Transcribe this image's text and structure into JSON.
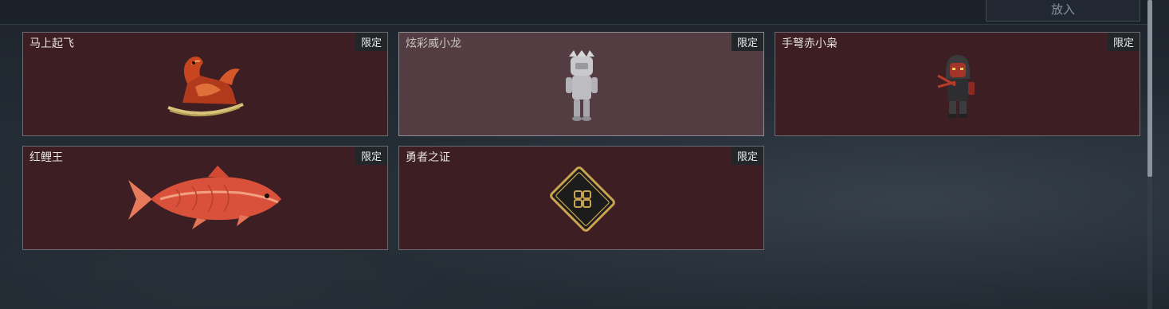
{
  "top_button_label": "放入",
  "badge_label": "限定",
  "items": [
    {
      "name": "马上起飞",
      "icon": "rocking-horse-dragon-icon"
    },
    {
      "name": "炫彩威小龙",
      "icon": "dragon-figurine-icon"
    },
    {
      "name": "手弩赤小枭",
      "icon": "crossbow-figurine-icon"
    },
    {
      "name": "红鲤王",
      "icon": "red-carp-icon"
    },
    {
      "name": "勇者之证",
      "icon": "hero-card-icon"
    }
  ],
  "colors": {
    "card_bg": "#3c1e23",
    "card_bg_selected": "#543c43",
    "badge_bg": "#232629"
  }
}
